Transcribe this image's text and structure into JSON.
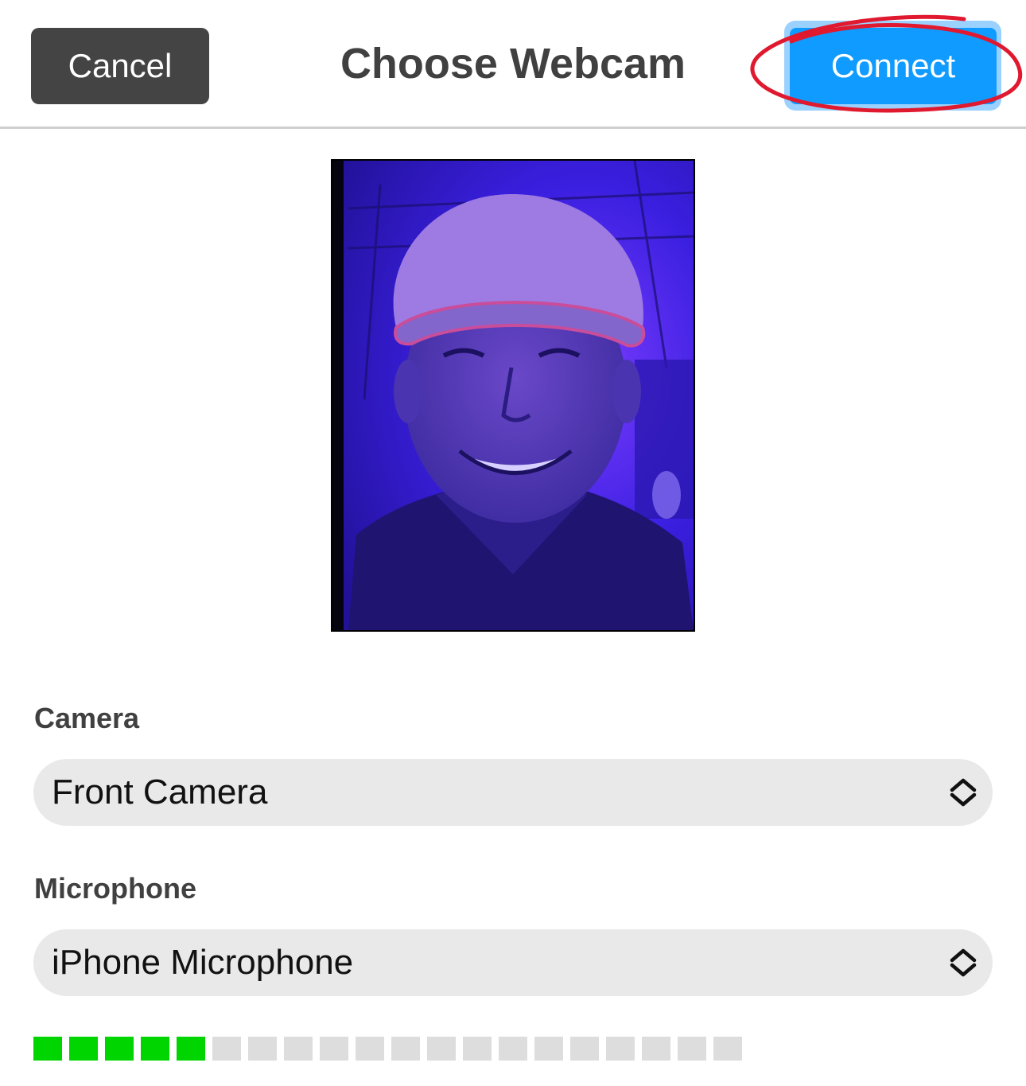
{
  "header": {
    "cancel_label": "Cancel",
    "title": "Choose Webcam",
    "connect_label": "Connect"
  },
  "preview": {
    "description_icon": "camera-preview-image"
  },
  "camera": {
    "label": "Camera",
    "selected": "Front Camera"
  },
  "microphone": {
    "label": "Microphone",
    "selected": "iPhone Microphone"
  },
  "audio_level": {
    "segments_total": 20,
    "segments_active": 5,
    "active_color": "#00d500",
    "inactive_color": "#dddddd"
  },
  "colors": {
    "connect": "#0f9bff",
    "cancel": "#444444",
    "annotation": "#e0192f"
  }
}
